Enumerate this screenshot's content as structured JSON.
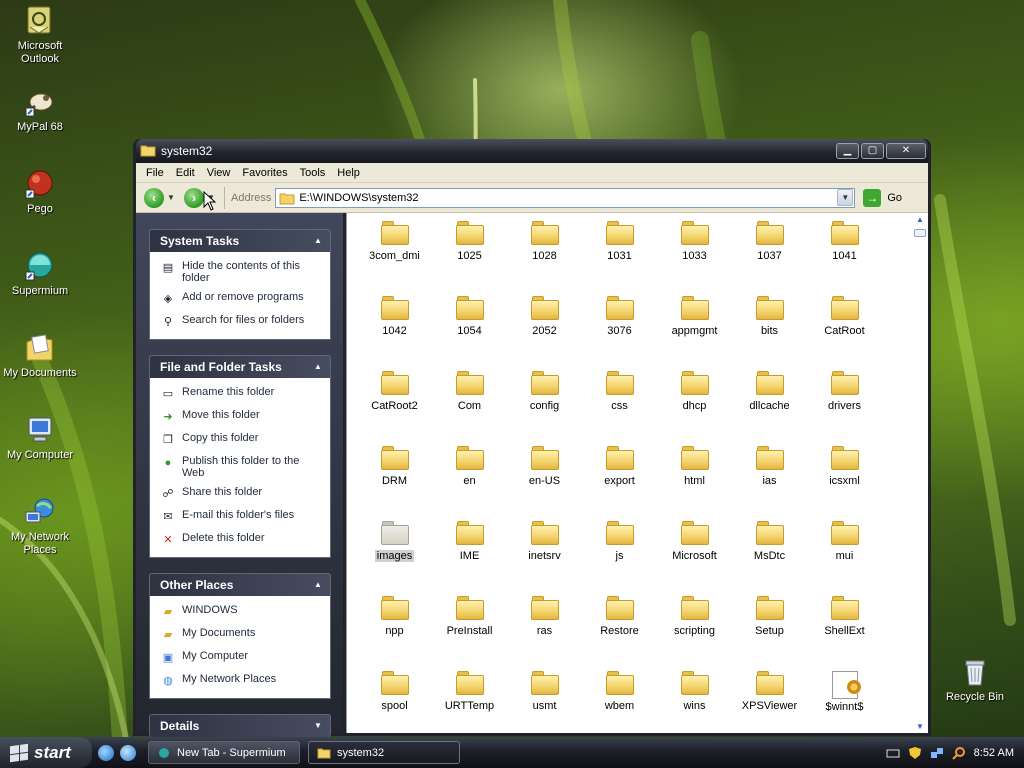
{
  "desktop": {
    "icons": [
      {
        "label": "Microsoft Outlook",
        "icon": "outlook-icon"
      },
      {
        "label": "MyPal 68",
        "icon": "mypal-icon"
      },
      {
        "label": "Pego",
        "icon": "pego-icon"
      },
      {
        "label": "Supermium",
        "icon": "supermium-icon"
      },
      {
        "label": "My Documents",
        "icon": "my-documents-icon"
      },
      {
        "label": "My Computer",
        "icon": "my-computer-icon"
      },
      {
        "label": "My Network Places",
        "icon": "network-places-icon"
      },
      {
        "label": "Recycle Bin",
        "icon": "recycle-bin-icon"
      }
    ]
  },
  "window": {
    "title": "system32",
    "menu": [
      "File",
      "Edit",
      "View",
      "Favorites",
      "Tools",
      "Help"
    ],
    "address_label": "Address",
    "address_value": "E:\\WINDOWS\\system32",
    "go_label": "Go"
  },
  "taskpane": {
    "system_tasks": {
      "title": "System Tasks",
      "items": [
        "Hide the contents of this folder",
        "Add or remove programs",
        "Search for files or folders"
      ]
    },
    "file_folder_tasks": {
      "title": "File and Folder Tasks",
      "items": [
        "Rename this folder",
        "Move this folder",
        "Copy this folder",
        "Publish this folder to the Web",
        "Share this folder",
        "E-mail this folder's files",
        "Delete this folder"
      ]
    },
    "other_places": {
      "title": "Other Places",
      "items": [
        "WINDOWS",
        "My Documents",
        "My Computer",
        "My Network Places"
      ]
    },
    "details": {
      "title": "Details"
    }
  },
  "files": [
    "3com_dmi",
    "1025",
    "1028",
    "1031",
    "1033",
    "1037",
    "1041",
    "1042",
    "1054",
    "2052",
    "3076",
    "appmgmt",
    "bits",
    "CatRoot",
    "CatRoot2",
    "Com",
    "config",
    "css",
    "dhcp",
    "dllcache",
    "drivers",
    "DRM",
    "en",
    "en-US",
    "export",
    "html",
    "ias",
    "icsxml",
    "images",
    "IME",
    "inetsrv",
    "js",
    "Microsoft",
    "MsDtc",
    "mui",
    "npp",
    "PreInstall",
    "ras",
    "Restore",
    "scripting",
    "Setup",
    "ShellExt",
    "spool",
    "URTTemp",
    "usmt",
    "wbem",
    "wins",
    "XPSViewer",
    "$winnt$"
  ],
  "selected_file": "images",
  "taskbar": {
    "start_label": "start",
    "tasks": [
      "New Tab - Supermium",
      "system32"
    ],
    "clock": "8:52 AM"
  }
}
